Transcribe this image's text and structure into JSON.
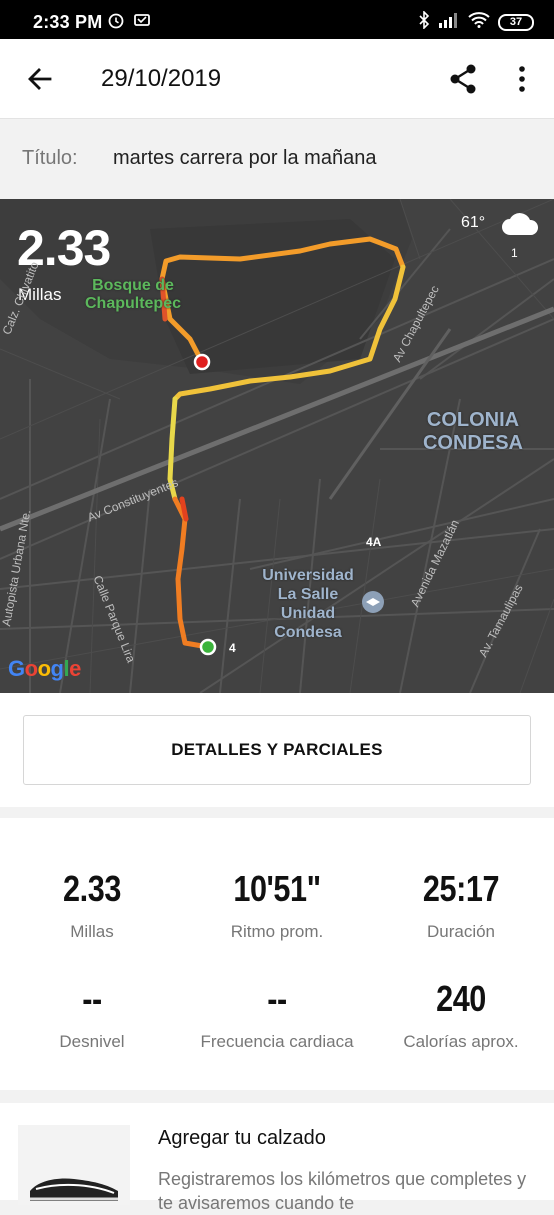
{
  "status_bar": {
    "time": "2:33 PM",
    "battery": "37"
  },
  "app_bar": {
    "title": "29/10/2019",
    "icons": [
      "arrow-back-icon",
      "share-icon",
      "more-vert-icon"
    ]
  },
  "activity": {
    "title_label": "Título:",
    "title_value": "martes carrera por la mañana"
  },
  "map": {
    "distance": "2.33",
    "units": "Millas",
    "temperature": "61°",
    "weather_icon": "cloud-icon",
    "weather_value": "1",
    "labels": {
      "park": "Bosque de Chapultepec",
      "colonia": "COLONIA CONDESA",
      "university": "Universidad La Salle Unidad Condesa",
      "route_marker": "4",
      "road_4a": "4A"
    },
    "streets": {
      "constituyentes": "Av Constituyentes",
      "chapultepec": "Av Chapultepec",
      "autopista": "Autopista Urbana Nte.",
      "parque_lira": "Calle Parque Lira",
      "mazatlan": "Avenida Mazatlán",
      "tamaulipas": "Av. Tamaulipas",
      "chivatito": "Calz. Chivatito"
    },
    "attribution": "Google"
  },
  "details_button": {
    "label": "DETALLES Y PARCIALES"
  },
  "stats": [
    {
      "value": "2.33",
      "label": "Millas"
    },
    {
      "value": "10'51\"",
      "label": "Ritmo prom."
    },
    {
      "value": "25:17",
      "label": "Duración"
    },
    {
      "value": "--",
      "label": "Desnivel"
    },
    {
      "value": "--",
      "label": "Frecuencia cardiaca"
    },
    {
      "value": "240",
      "label": "Calorías aprox."
    }
  ],
  "shoe": {
    "title": "Agregar tu calzado",
    "description": "Registraremos los kilómetros que completes y te avisaremos cuando te"
  }
}
